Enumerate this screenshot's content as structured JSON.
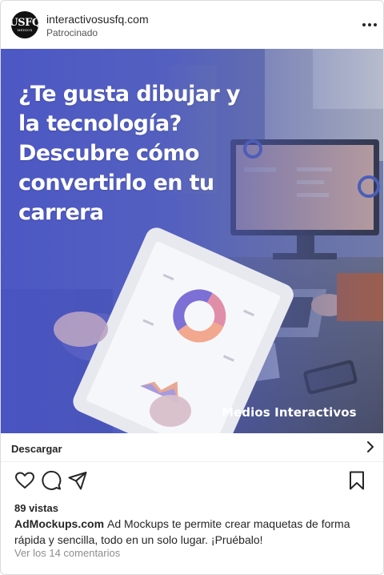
{
  "header": {
    "username": "interactivosusfq.com",
    "sponsored_label": "Patrocinado",
    "avatar_logo": "USFQ",
    "avatar_sub": "MEDIOS",
    "more_icon": "more-horizontal-icon"
  },
  "ad": {
    "headline_lines": [
      "¿Te gusta dibujar y",
      "la tecnología?",
      "Descubre cómo",
      "convertirlo en tu",
      "carrera"
    ],
    "brand_tag": "Medios Interactivos",
    "colors": {
      "overlay": "#4a57c4",
      "text": "#ffffff"
    }
  },
  "cta": {
    "label": "Descargar",
    "icon": "chevron-right-icon"
  },
  "actions": {
    "like_icon": "heart-icon",
    "comment_icon": "comment-icon",
    "share_icon": "send-icon",
    "save_icon": "bookmark-icon"
  },
  "footer": {
    "views": "89 vistas",
    "caption_user": "AdMockups.com",
    "caption_text": "Ad Mockups te permite crear maquetas de forma rápida y sencilla, todo en un solo lugar. ¡Pruébalo!",
    "comments_link": "Ver los 14 comentarios"
  }
}
